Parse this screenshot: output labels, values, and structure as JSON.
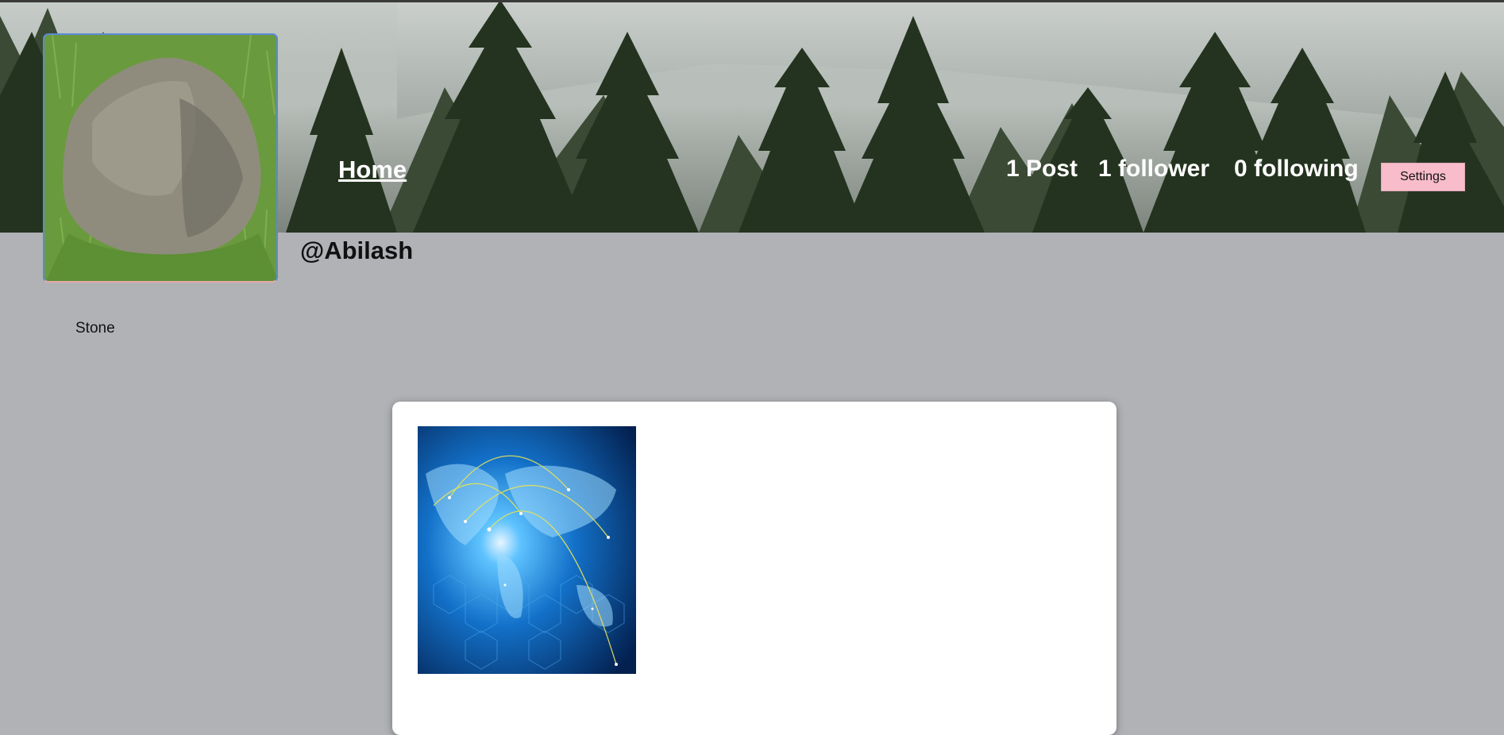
{
  "nav": {
    "home_label": "Home"
  },
  "profile": {
    "username": "@Abilash",
    "bio": "Stone",
    "avatar_icon": "boulder-photo",
    "cover_icon": "misty-forest-photo"
  },
  "stats": {
    "posts_label": "1 Post",
    "followers_label": "1 follower",
    "following_label": "0 following"
  },
  "actions": {
    "settings_label": "Settings"
  },
  "posts": [
    {
      "image_icon": "world-network-map-image"
    }
  ],
  "colors": {
    "page_background": "#b0b2b6",
    "settings_button": "#f8bccb",
    "card_background": "#ffffff"
  }
}
